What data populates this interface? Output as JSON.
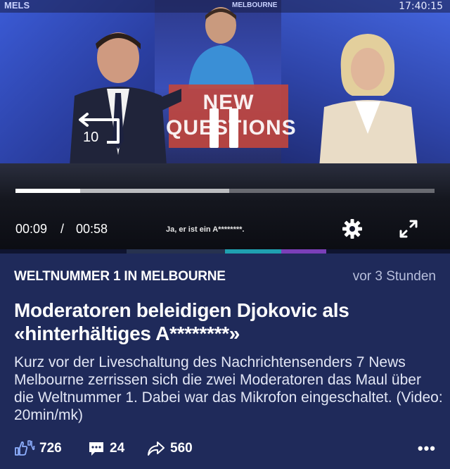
{
  "video": {
    "ticker_left": "MELS",
    "ticker_mid": "MELBOURNE",
    "clock": "17:40:15",
    "billboard_text": "NEW\nQUESTIONS",
    "replay_seconds": "10",
    "time_current": "00:09",
    "time_separator": "/",
    "time_total": "00:58",
    "subtitle": "Ja, er ist ein A********.",
    "progress_played_fraction": 0.155,
    "progress_buffered_fraction": 0.51,
    "icons": {
      "replay": "replay-10-icon",
      "pause": "pause-icon",
      "settings": "gear-icon",
      "fullscreen": "fullscreen-icon"
    }
  },
  "article": {
    "kicker": "WELTNUMMER 1 IN MELBOURNE",
    "timestamp": "vor 3 Stunden",
    "headline": "Moderatoren beleidigen Djokovic als «hinterhältiges A********»",
    "lead": "Kurz vor der Liveschaltung des Nachrichtensenders 7 News Melbourne zerrissen sich die zwei Moderatoren das Maul über die Weltnummer 1. Dabei war das Mikrofon eingeschaltet. (Video: 20min/mk)",
    "actions": {
      "reactions_count": "726",
      "comments_count": "24",
      "shares_count": "560",
      "more_label": "•••"
    }
  },
  "colors": {
    "article_background": "#1f2a5a",
    "strip_teal": "#1fa0b0",
    "strip_purple": "#7a3fb8"
  }
}
